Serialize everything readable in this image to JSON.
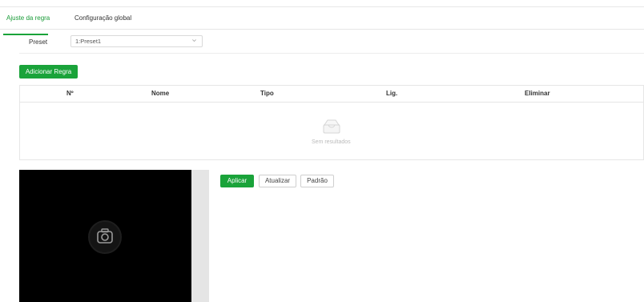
{
  "tabs": [
    {
      "label": "Ajuste da regra",
      "active": true
    },
    {
      "label": "Configuração global",
      "active": false
    }
  ],
  "preset": {
    "label": "Preset",
    "selected_value": "1:Preset1"
  },
  "add_rule_button": "Adicionar Regra",
  "table": {
    "columns": [
      "Nº",
      "Nome",
      "Tipo",
      "Lig.",
      "Eliminar"
    ],
    "empty_text": "Sem resultados"
  },
  "actions": {
    "apply": "Aplicar",
    "refresh": "Atualizar",
    "default": "Padrão"
  },
  "icons": {
    "camera": "camera-icon",
    "select_arrow": "chevron-down-icon",
    "empty": "empty-box-icon"
  },
  "colors": {
    "accent": "#1aa33a",
    "video_background": "#000000"
  }
}
